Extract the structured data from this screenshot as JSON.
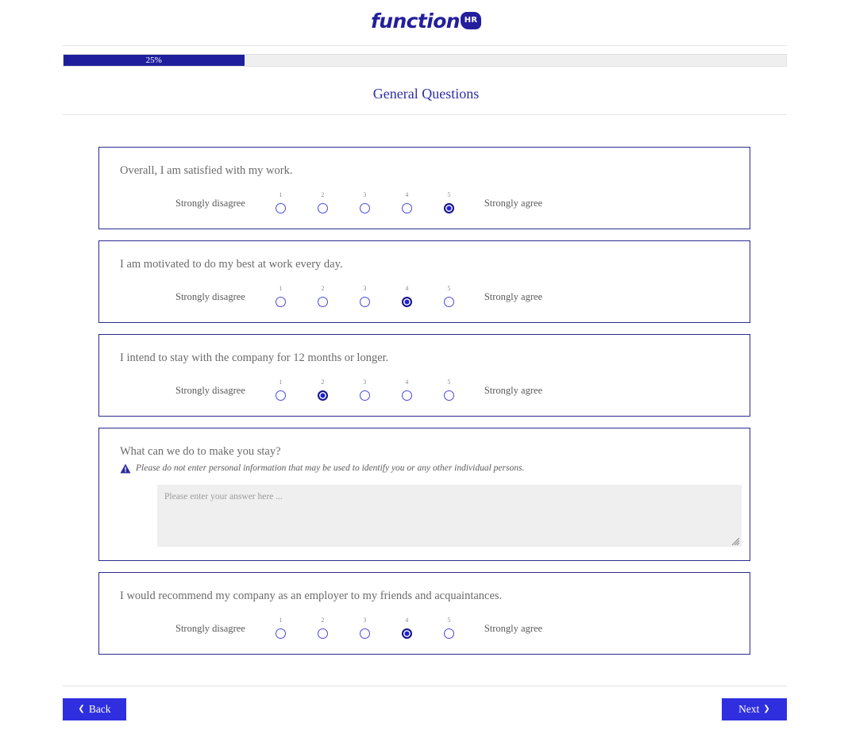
{
  "brand": {
    "name": "function",
    "badge": "HR",
    "color": "#241f9c"
  },
  "progress": {
    "percent_label": "25%",
    "percent_value": 25,
    "fill_color": "#1f1f9e",
    "track_color": "#efefef"
  },
  "page": {
    "title": "General Questions"
  },
  "scale": {
    "left_label": "Strongly disagree",
    "right_label": "Strongly agree",
    "numbers": [
      "1",
      "2",
      "3",
      "4",
      "5"
    ]
  },
  "questions": [
    {
      "id": "q1",
      "type": "likert",
      "text": "Overall, I am satisfied with my work.",
      "selected": 5
    },
    {
      "id": "q2",
      "type": "likert",
      "text": "I am motivated to do my best at work every day.",
      "selected": 4
    },
    {
      "id": "q3",
      "type": "likert",
      "text": "I intend to stay with the company for 12 months or longer.",
      "selected": 2
    },
    {
      "id": "q4",
      "type": "freetext",
      "text": "What can we do to make you stay?",
      "warning": "Please do not enter personal information that may be used to identify you or any other individual persons.",
      "warning_icon": "warning-triangle-icon",
      "placeholder": "Please enter your answer here ...",
      "value": ""
    },
    {
      "id": "q5",
      "type": "likert",
      "text": "I would recommend my company as an employer to my friends and acquaintances.",
      "selected": 4
    }
  ],
  "footer": {
    "back_label": "Back",
    "back_icon": "chevron-left-icon",
    "next_label": "Next",
    "next_icon": "chevron-right-icon",
    "button_color": "#2f2fe0"
  }
}
